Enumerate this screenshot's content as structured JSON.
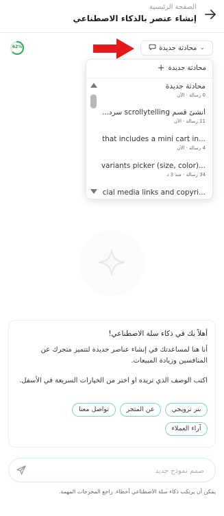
{
  "header": {
    "subtitle": "الصفحة الرئيسية",
    "title": "إنشاء عنصر بالذكاء الاصطناعي",
    "back_icon": "arrow-right-icon"
  },
  "progress": {
    "label": "62%",
    "value": 0.62,
    "color": "#2fb35c"
  },
  "new_chat_button": {
    "label": "محادثة جديدة",
    "icon": "chat-bubble-icon"
  },
  "annotation": {
    "arrow_color": "#e3191c"
  },
  "dropdown": {
    "new_label": "محادثة جديدة",
    "new_icon": "plus-icon",
    "items": [
      {
        "title": "محادثة جديدة",
        "meta": "0 رسالة · الآن"
      },
      {
        "title": "أنشئ قسم scrollytelling سرد...",
        "meta": "11 رسالة · الآن"
      },
      {
        "title": "...that includes a mini cart in",
        "meta": "4 رسالة · الآن"
      },
      {
        "title": "...variants picker (size, color)",
        "meta": "34 رسالة · منذ 3 د"
      },
      {
        "title": "...cial media links and copyri",
        "meta": ""
      }
    ]
  },
  "welcome": {
    "heading": "أهلاً بك في ذكاء سلة الاصطناعي!",
    "body1": "أنا هنا لمساعدتك في إنشاء عناصر جديدة لتتميز متجرك عن المنافسين وزيادة المبيعات.",
    "body2": "اكتب الوصف الذي تريده او اختر من الخيارات السريعة في الأسفل.",
    "chips": [
      "بنر ترويجي",
      "عن المتجر",
      "تواصل معنا",
      "آراء العملاء"
    ]
  },
  "input": {
    "placeholder": "صمم نموذج جديد",
    "value": "",
    "send_icon": "send-icon"
  },
  "disclaimer": "يمكن أن يرتكب ذكاء سلة الاصطناعي أخطاء. راجع المخرجات المهمة."
}
